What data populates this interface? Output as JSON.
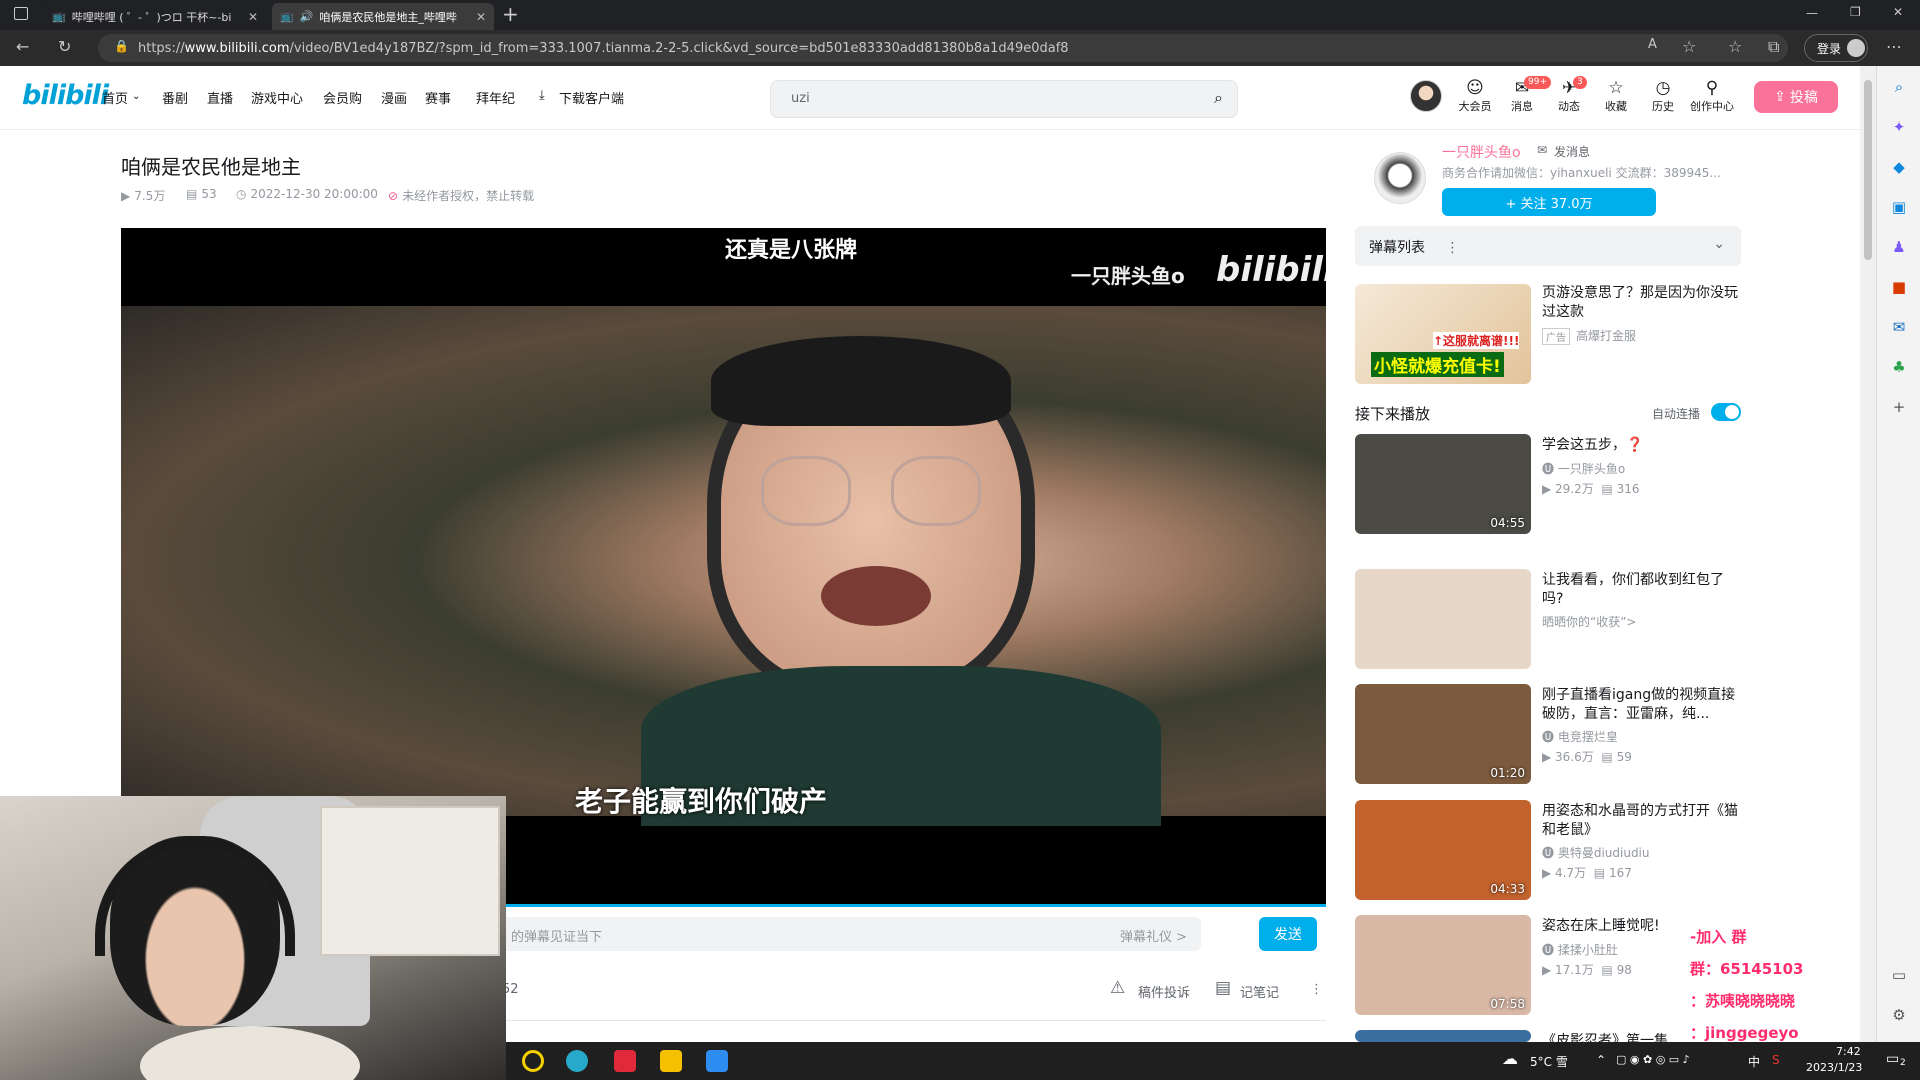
{
  "browser": {
    "tabs": [
      {
        "title": "哔哩哔哩 ( ゜- ゜)つロ 干杯~-bili",
        "active": false
      },
      {
        "title": "咱俩是农民他是地主_哔哩哔",
        "active": true
      }
    ],
    "new_tab": "+",
    "url_prefix": "https://",
    "url_domain": "www.bilibili.com",
    "url_path": "/video/BV1ed4y187BZ/?spm_id_from=333.1007.tianma.2-2-5.click&vd_source=bd501e83330add81380b8a1d49e0daf8",
    "login_label": "登录",
    "window_controls": [
      "—",
      "❐",
      "✕"
    ]
  },
  "header": {
    "logo": "bilibili",
    "nav": [
      "首页",
      "番剧",
      "直播",
      "游戏中心",
      "会员购",
      "漫画",
      "赛事",
      "拜年纪",
      "下载客户端"
    ],
    "search_value": "uzi",
    "icons": [
      {
        "label": "大会员",
        "icon": "vip-icon",
        "badge": ""
      },
      {
        "label": "消息",
        "icon": "message-icon",
        "badge": "99+"
      },
      {
        "label": "动态",
        "icon": "dynamic-icon",
        "badge": "3"
      },
      {
        "label": "收藏",
        "icon": "star-icon",
        "badge": ""
      },
      {
        "label": "历史",
        "icon": "clock-icon",
        "badge": ""
      },
      {
        "label": "创作中心",
        "icon": "bulb-icon",
        "badge": ""
      }
    ],
    "upload_label": "投稿"
  },
  "video": {
    "title": "咱俩是农民他是地主",
    "views": "7.5万",
    "danmaku_count": "53",
    "date": "2022-12-30 20:00:00",
    "copyright": "未经作者授权，禁止转载",
    "caption_top": "还真是八张牌",
    "watermark": "一只胖头鱼o",
    "watermark_logo": "bilibili",
    "caption_bottom": "老子能赢到你们破产",
    "danmaku_placeholder": "的弹幕见证当下",
    "danmaku_etiquette": "弹幕礼仪 >",
    "send_label": "发送",
    "left_number": "52",
    "report_label": "稿件投诉",
    "note_label": "记笔记"
  },
  "uploader": {
    "name": "一只胖头鱼o",
    "message_label": "发消息",
    "desc": "商务合作请加微信：yihanxueli 交流群：389945...",
    "follow_label": "+ 关注 37.0万"
  },
  "danmaku_list": {
    "label": "弹幕列表"
  },
  "ad": {
    "title": "页游没意思了？那是因为你没玩过这款",
    "tag": "广告",
    "source": "高爆打金服",
    "thumb_text1": "↑这服就离谱!!!",
    "thumb_text2": "小怪就爆充值卡!"
  },
  "up_next": {
    "label": "接下来播放",
    "autoplay_label": "自动连播",
    "autoplay_on": true
  },
  "recommendations": [
    {
      "title": "学会这五步，❓",
      "author": "一只胖头鱼o",
      "views": "29.2万",
      "danmaku": "316",
      "duration": "04:55",
      "thumb_color": "#4b4a44"
    },
    {
      "title": "让我看看，你们都收到红包了吗?",
      "author": "晒晒你的“收获”>",
      "views": "",
      "danmaku": "",
      "duration": "",
      "thumb_color": "#e6d7c8"
    },
    {
      "title": "刚子直播看igang做的视频直接破防，直言：亚雷麻，纯...",
      "author": "电竞摆烂皇",
      "views": "36.6万",
      "danmaku": "59",
      "duration": "01:20",
      "thumb_color": "#7b5a3d"
    },
    {
      "title": "用姿态和水晶哥的方式打开《猫和老鼠》",
      "author": "奥特曼diudiudiu",
      "views": "4.7万",
      "danmaku": "167",
      "duration": "04:33",
      "thumb_color": "#c2622d"
    },
    {
      "title": "姿态在床上睡觉呢!",
      "author": "揉揉小肚肚",
      "views": "17.1万",
      "danmaku": "98",
      "duration": "07:58",
      "thumb_color": "#d9b8a6"
    },
    {
      "title": "《皮影忍者》第一集",
      "author": "",
      "views": "",
      "danmaku": "",
      "duration": "",
      "thumb_color": "#3b6fa0"
    }
  ],
  "overlay": {
    "line1": "-加入 群",
    "line2": "群：65145103",
    "line3": "：苏咦晓晓晓晓",
    "line4": "：jinggegeyo"
  },
  "taskbar": {
    "weather": "5°C 雪",
    "ime": "中",
    "time": "7:42",
    "date": "2023/1/23",
    "notifications": "2"
  }
}
